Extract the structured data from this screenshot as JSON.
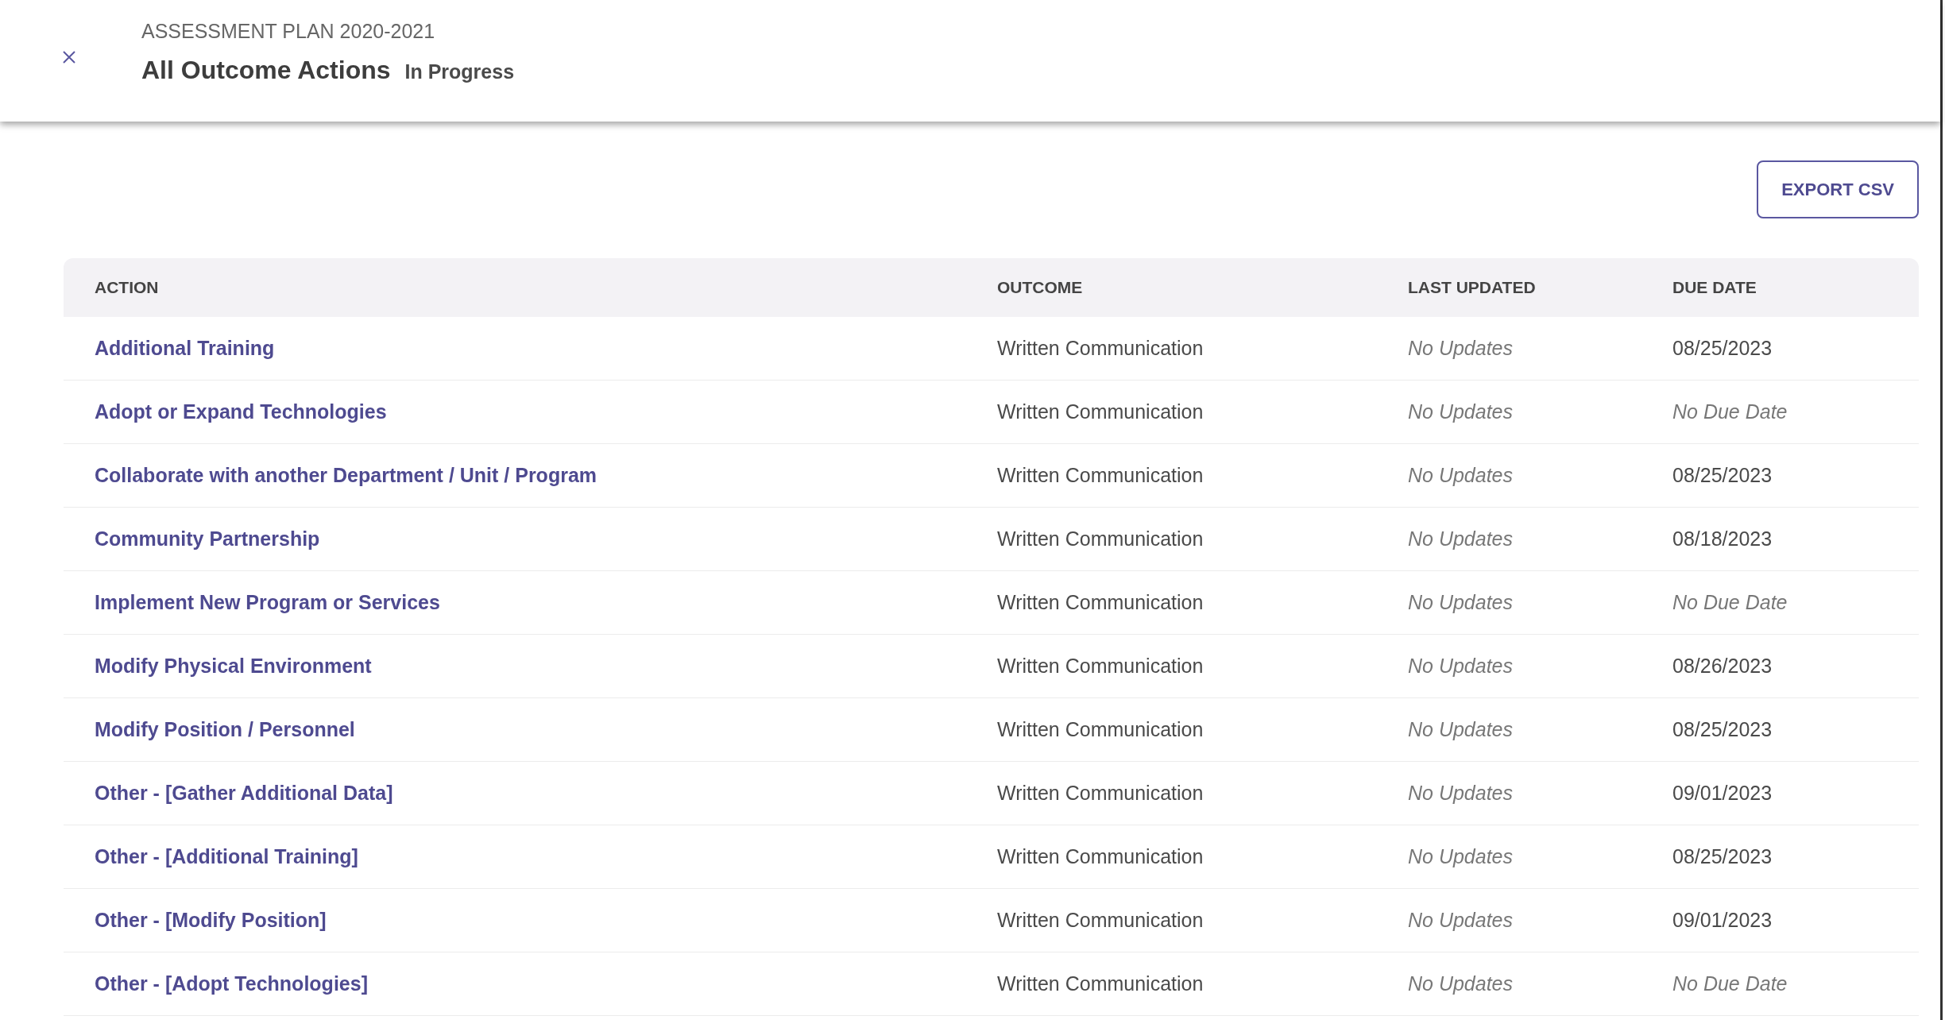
{
  "header": {
    "eyebrow": "ASSESSMENT PLAN 2020-2021",
    "title": "All Outcome Actions",
    "status": "In Progress"
  },
  "export_button": "EXPORT CSV",
  "table": {
    "columns": [
      "ACTION",
      "OUTCOME",
      "LAST UPDATED",
      "DUE DATE"
    ],
    "rows": [
      {
        "action": "Additional Training",
        "outcome": "Written Communication",
        "last_updated": {
          "text": "No Updates",
          "empty": true
        },
        "due_date": {
          "text": "08/25/2023",
          "empty": false
        }
      },
      {
        "action": "Adopt or Expand Technologies",
        "outcome": "Written Communication",
        "last_updated": {
          "text": "No Updates",
          "empty": true
        },
        "due_date": {
          "text": "No Due Date",
          "empty": true
        }
      },
      {
        "action": "Collaborate with another Department / Unit / Program",
        "outcome": "Written Communication",
        "last_updated": {
          "text": "No Updates",
          "empty": true
        },
        "due_date": {
          "text": "08/25/2023",
          "empty": false
        }
      },
      {
        "action": "Community Partnership",
        "outcome": "Written Communication",
        "last_updated": {
          "text": "No Updates",
          "empty": true
        },
        "due_date": {
          "text": "08/18/2023",
          "empty": false
        }
      },
      {
        "action": "Implement New Program or Services",
        "outcome": "Written Communication",
        "last_updated": {
          "text": "No Updates",
          "empty": true
        },
        "due_date": {
          "text": "No Due Date",
          "empty": true
        }
      },
      {
        "action": "Modify Physical Environment",
        "outcome": "Written Communication",
        "last_updated": {
          "text": "No Updates",
          "empty": true
        },
        "due_date": {
          "text": "08/26/2023",
          "empty": false
        }
      },
      {
        "action": "Modify Position / Personnel",
        "outcome": "Written Communication",
        "last_updated": {
          "text": "No Updates",
          "empty": true
        },
        "due_date": {
          "text": "08/25/2023",
          "empty": false
        }
      },
      {
        "action": "Other - [Gather Additional Data]",
        "outcome": "Written Communication",
        "last_updated": {
          "text": "No Updates",
          "empty": true
        },
        "due_date": {
          "text": "09/01/2023",
          "empty": false
        }
      },
      {
        "action": "Other - [Additional Training]",
        "outcome": "Written Communication",
        "last_updated": {
          "text": "No Updates",
          "empty": true
        },
        "due_date": {
          "text": "08/25/2023",
          "empty": false
        }
      },
      {
        "action": "Other - [Modify Position]",
        "outcome": "Written Communication",
        "last_updated": {
          "text": "No Updates",
          "empty": true
        },
        "due_date": {
          "text": "09/01/2023",
          "empty": false
        }
      },
      {
        "action": "Other - [Adopt Technologies]",
        "outcome": "Written Communication",
        "last_updated": {
          "text": "No Updates",
          "empty": true
        },
        "due_date": {
          "text": "No Due Date",
          "empty": true
        }
      }
    ]
  }
}
